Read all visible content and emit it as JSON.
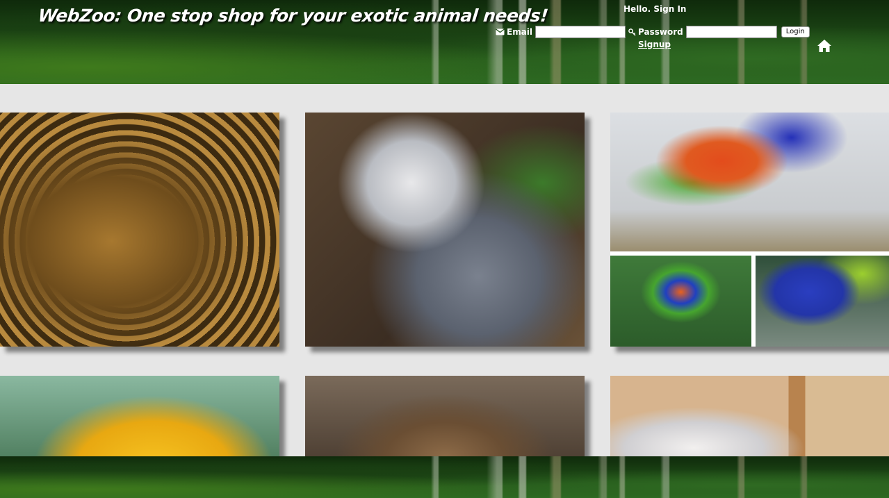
{
  "header": {
    "logo_text": "WebZoo: One stop shop for your exotic animal needs!",
    "greeting": "Hello. Sign In",
    "email_label": "Email",
    "email_value": "",
    "password_label": "Password",
    "password_value": "",
    "login_label": "Login",
    "signup_label": "Signup",
    "icons": [
      "envelope-icon",
      "key-icon",
      "home-icon"
    ]
  },
  "gallery": {
    "tiles": [
      {
        "subject": "python"
      },
      {
        "subject": "harpy-eagle"
      },
      {
        "subject": "rainbow-lorikeets"
      },
      {
        "subject": "yellow-cockatoo"
      },
      {
        "subject": "big-cat-cub"
      },
      {
        "subject": "white-tiger-cub"
      }
    ]
  }
}
